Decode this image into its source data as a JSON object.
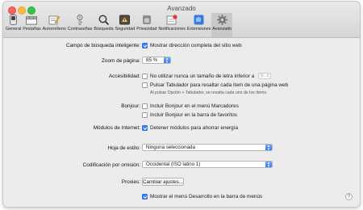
{
  "window": {
    "title": "Avanzado"
  },
  "toolbar": {
    "tabs": [
      {
        "label": "General",
        "icon": "general-switch-icon"
      },
      {
        "label": "Pestañas",
        "icon": "tabs-icon"
      },
      {
        "label": "Autorrelleno",
        "icon": "autofill-pencil-icon"
      },
      {
        "label": "Contraseñas",
        "icon": "key-icon"
      },
      {
        "label": "Búsqueda",
        "icon": "magnifier-icon"
      },
      {
        "label": "Seguridad",
        "icon": "security-icon"
      },
      {
        "label": "Privacidad",
        "icon": "privacy-hand-icon"
      },
      {
        "label": "Notificaciones",
        "icon": "notifications-icon"
      },
      {
        "label": "Extensiones",
        "icon": "extensions-puzzle-icon"
      },
      {
        "label": "Avanzado",
        "icon": "gear-icon"
      }
    ],
    "active": "Avanzado"
  },
  "settings": {
    "smart_search": {
      "label": "Campo de búsqueda inteligente:",
      "option": "Mostrar dirección completa del sitio web",
      "checked": true
    },
    "zoom": {
      "label": "Zoom de página:",
      "value": "85 %"
    },
    "accessibility": {
      "label": "Accesibilidad:",
      "min_font": {
        "text": "No utilizar nunca un tamaño de letra inferior a",
        "value": "9",
        "checked": false
      },
      "tab_key": {
        "text": "Pulsar Tabulador para resaltar cada ítem de una página web",
        "checked": false
      },
      "note": "Al pulsar Opción + Tabulador, se resalta cada uno de los ítems."
    },
    "bonjour": {
      "label": "Bonjour:",
      "bookmarks_menu": {
        "text": "Incluir Bonjour en el menú Marcadores",
        "checked": false
      },
      "favorites_bar": {
        "text": "Incluir Bonjour en la barra de favoritos",
        "checked": false
      }
    },
    "plugins": {
      "label": "Módulos de Internet:",
      "option": "Detener módulos para ahorrar energía",
      "checked": true
    },
    "stylesheet": {
      "label": "Hoja de estilo:",
      "value": "Ninguna seleccionada"
    },
    "encoding": {
      "label": "Codificación por omisión:",
      "value": "Occidental (ISO latino 1)"
    },
    "proxies": {
      "label": "Proxies:",
      "button": "Cambiar ajustes..."
    },
    "develop_menu": {
      "text": "Mostrar el menú Desarrollo en la barra de menús",
      "checked": true
    }
  },
  "help": {
    "label": "?"
  },
  "colors": {
    "accent": "#3b82f7"
  }
}
